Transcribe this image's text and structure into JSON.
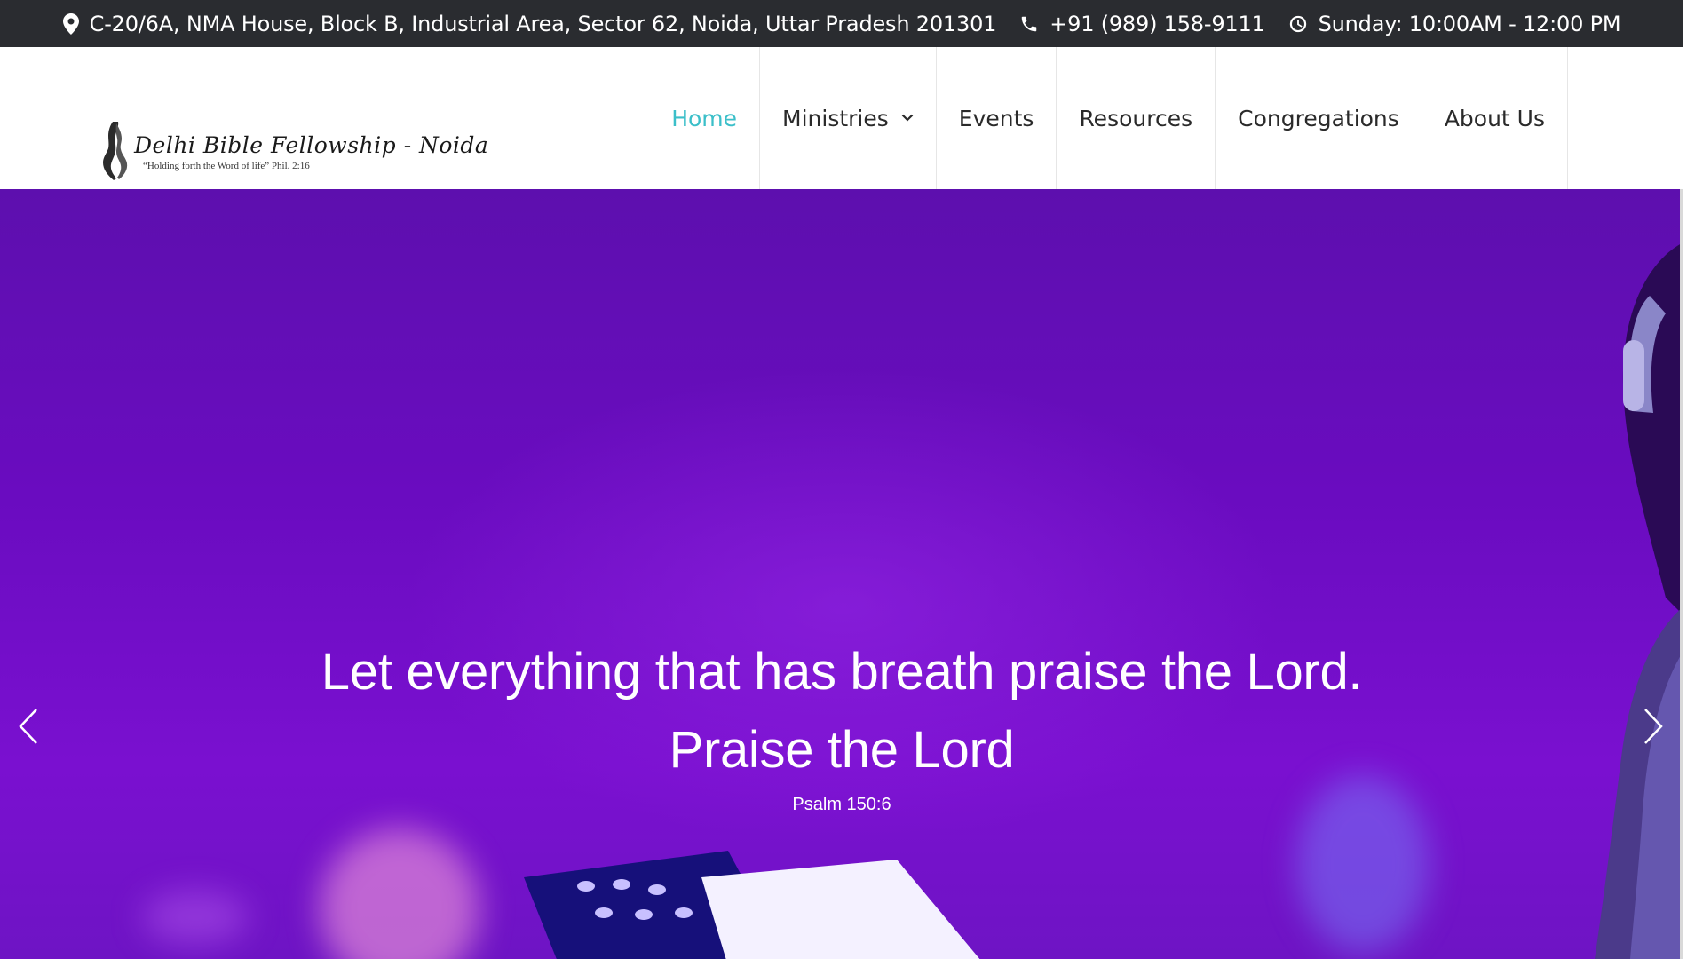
{
  "topbar": {
    "address": "C-20/6A, NMA House, Block B, Industrial Area, Sector 62, Noida, Uttar Pradesh 201301",
    "address_icon": "map-pin-icon",
    "phone": "+91 (989) 158-9111",
    "phone_icon": "phone-icon",
    "hours": "Sunday: 10:00AM - 12:00 PM",
    "hours_icon": "clock-icon"
  },
  "logo": {
    "title": "Delhi Bible Fellowship - Noida",
    "tagline": "“Holding forth the Word of life” Phil. 2:16"
  },
  "nav": {
    "items": [
      {
        "label": "Home",
        "active": true
      },
      {
        "label": "Ministries",
        "has_dropdown": true
      },
      {
        "label": "Events"
      },
      {
        "label": "Resources"
      },
      {
        "label": "Congregations"
      },
      {
        "label": "About Us"
      }
    ]
  },
  "hero": {
    "line1": "Let everything that has breath praise the Lord.",
    "line2": "Praise the Lord",
    "reference": "Psalm 150:6",
    "prev_icon": "chevron-left-icon",
    "next_icon": "chevron-right-icon"
  },
  "colors": {
    "topbar_bg": "#2a2c30",
    "accent": "#3bbfc9",
    "hero_purple": "#6a0cc0"
  }
}
